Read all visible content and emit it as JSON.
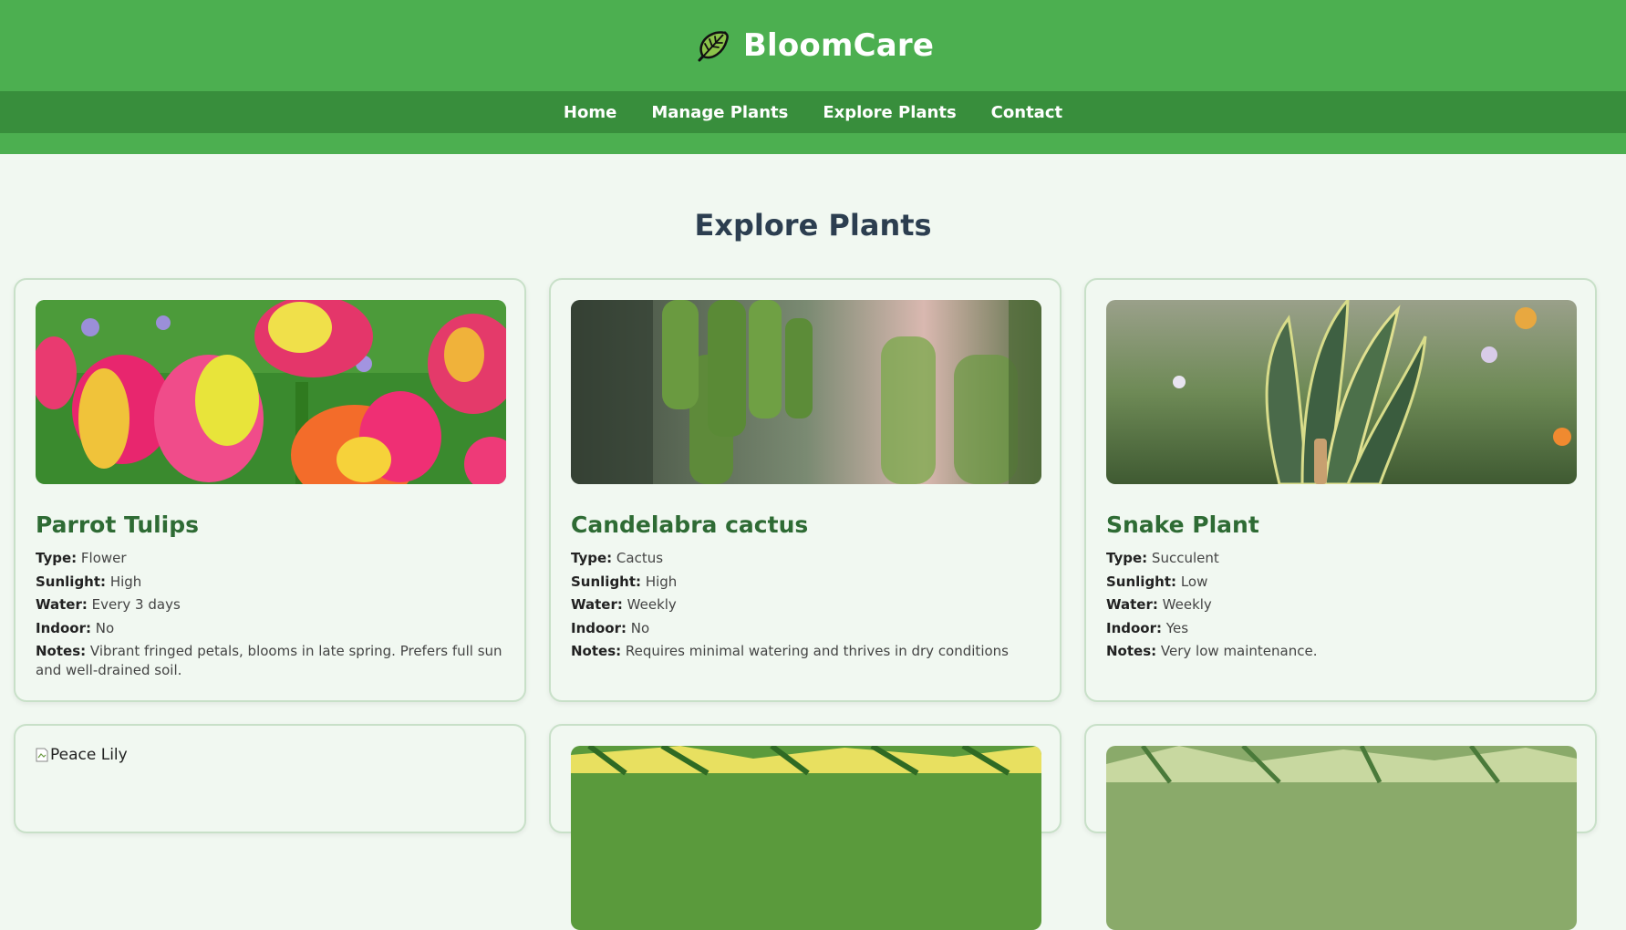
{
  "brand": {
    "title": "BloomCare",
    "icon": "leaf-icon"
  },
  "nav": {
    "items": [
      {
        "label": "Home"
      },
      {
        "label": "Manage Plants"
      },
      {
        "label": "Explore Plants"
      },
      {
        "label": "Contact"
      }
    ]
  },
  "main": {
    "title": "Explore Plants"
  },
  "labels": {
    "type": "Type:",
    "sunlight": "Sunlight:",
    "water": "Water:",
    "indoor": "Indoor:",
    "notes": "Notes:"
  },
  "plants": [
    {
      "name": "Parrot Tulips",
      "type": "Flower",
      "sunlight": "High",
      "water": "Every 3 days",
      "indoor": "No",
      "notes": "Vibrant fringed petals, blooms in late spring. Prefers full sun and well-drained soil."
    },
    {
      "name": "Candelabra cactus",
      "type": "Cactus",
      "sunlight": "High",
      "water": "Weekly",
      "indoor": "No",
      "notes": "Requires minimal watering and thrives in dry conditions"
    },
    {
      "name": "Snake Plant",
      "type": "Succulent",
      "sunlight": "Low",
      "water": "Weekly",
      "indoor": "Yes",
      "notes": "Very low maintenance."
    },
    {
      "alt": "Peace Lily"
    }
  ],
  "colors": {
    "header": "#4caf50",
    "nav": "#388e3c",
    "background": "#f1f8f1",
    "plant_name": "#2e6b34",
    "title": "#2c3e50"
  }
}
